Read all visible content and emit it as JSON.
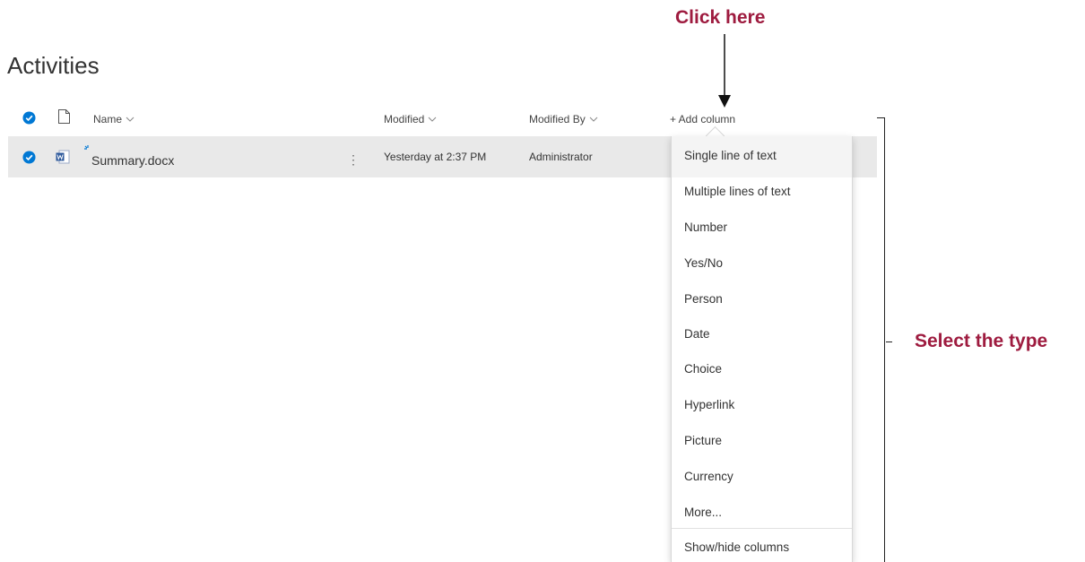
{
  "annotations": {
    "click_here": "Click here",
    "select_type": "Select the type"
  },
  "page": {
    "title": "Activities"
  },
  "columns": {
    "name": "Name",
    "modified": "Modified",
    "modified_by": "Modified By",
    "add_column": "+ Add column"
  },
  "files": [
    {
      "name": "Summary.docx",
      "modified": "Yesterday at 2:37 PM",
      "modified_by": "Administrator",
      "more": "⋮"
    }
  ],
  "add_column_menu": {
    "items": [
      "Single line of text",
      "Multiple lines of text",
      "Number",
      "Yes/No",
      "Person",
      "Date",
      "Choice",
      "Hyperlink",
      "Picture",
      "Currency",
      "More...",
      "Show/hide columns"
    ]
  },
  "colors": {
    "accent": "#0078d4",
    "callout": "#9e1b3f",
    "selected_row": "#e9e9e9",
    "word_blue": "#2b579a"
  },
  "icons": {
    "select_all": "check-circle-icon",
    "file_type": "document-icon",
    "word_file": "word-doc-icon",
    "sort": "chevron-down-icon"
  }
}
